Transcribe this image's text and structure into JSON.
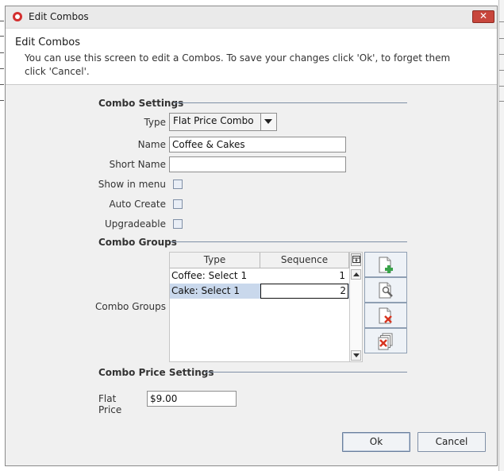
{
  "window": {
    "title": "Edit Combos",
    "close_symbol": "✕"
  },
  "header": {
    "title": "Edit Combos",
    "description": "You can use this screen to edit a Combos. To save your changes click 'Ok', to forget them click 'Cancel'."
  },
  "combo_settings": {
    "section_title": "Combo Settings",
    "type_label": "Type",
    "type_value": "Flat Price Combo",
    "name_label": "Name",
    "name_value": "Coffee & Cakes",
    "short_name_label": "Short Name",
    "short_name_value": "",
    "show_in_menu_label": "Show in menu",
    "show_in_menu_checked": false,
    "auto_create_label": "Auto Create",
    "auto_create_checked": false,
    "upgradeable_label": "Upgradeable",
    "upgradeable_checked": false
  },
  "combo_groups": {
    "section_title": "Combo Groups",
    "field_label": "Combo Groups",
    "columns": [
      "Type",
      "Sequence"
    ],
    "rows": [
      {
        "type": "Coffee: Select 1",
        "sequence": "1"
      },
      {
        "type": "Cake: Select 1",
        "sequence": "2"
      }
    ],
    "selected_row": 1,
    "toolbar": [
      "add-icon",
      "edit-icon",
      "delete-icon",
      "delete-all-icon"
    ]
  },
  "price_settings": {
    "section_title": "Combo Price Settings",
    "flat_price_label": "Flat Price",
    "flat_price_value": "$9.00"
  },
  "footer": {
    "ok_label": "Ok",
    "cancel_label": "Cancel"
  },
  "colors": {
    "selected_row": "#c9d8ec",
    "accent": "#7f8fa6",
    "close": "#c8463c"
  }
}
